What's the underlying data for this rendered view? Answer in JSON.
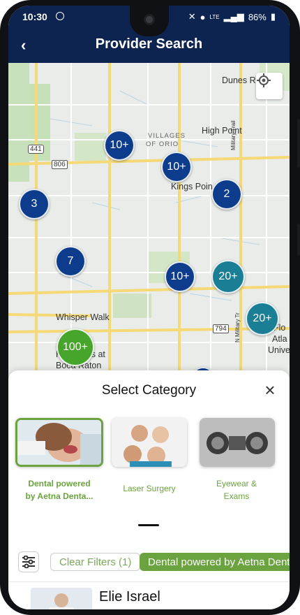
{
  "status_bar": {
    "time": "10:30",
    "battery": "86%",
    "network": "LTE"
  },
  "header": {
    "title": "Provider Search",
    "back_icon": "back-arrow-icon"
  },
  "map": {
    "labels": [
      "Dunes Ro",
      "VILLAGES",
      "OF ORIO",
      "High Point",
      "Kings Poin",
      "Military Trail",
      "Whisper Walk",
      "Hamptons at",
      "Boca Raton",
      "N Military Tr",
      "Flo",
      "Atla",
      "Unive"
    ],
    "shields": [
      "441",
      "806",
      "794"
    ],
    "clusters": [
      "10+",
      "10+",
      "3",
      "2",
      "7",
      "10+",
      "20+",
      "20+",
      "100+"
    ]
  },
  "sheet": {
    "title": "Select Category",
    "categories": [
      {
        "label_line1": "Dental powered",
        "label_line2": "by Aetna Denta...",
        "selected": true
      },
      {
        "label_line1": "Laser Surgery",
        "label_line2": "",
        "selected": false
      },
      {
        "label_line1": "Eyewear &",
        "label_line2": "Exams",
        "selected": false
      }
    ]
  },
  "filters": {
    "clear_label": "Clear Filters (1)",
    "active_chip": "Dental powered by Aetna Dental"
  },
  "results": [
    {
      "name": "Elie Israel"
    }
  ],
  "colors": {
    "navy": "#0d2450",
    "green": "#6aa33f",
    "teal": "#1a7f94"
  }
}
